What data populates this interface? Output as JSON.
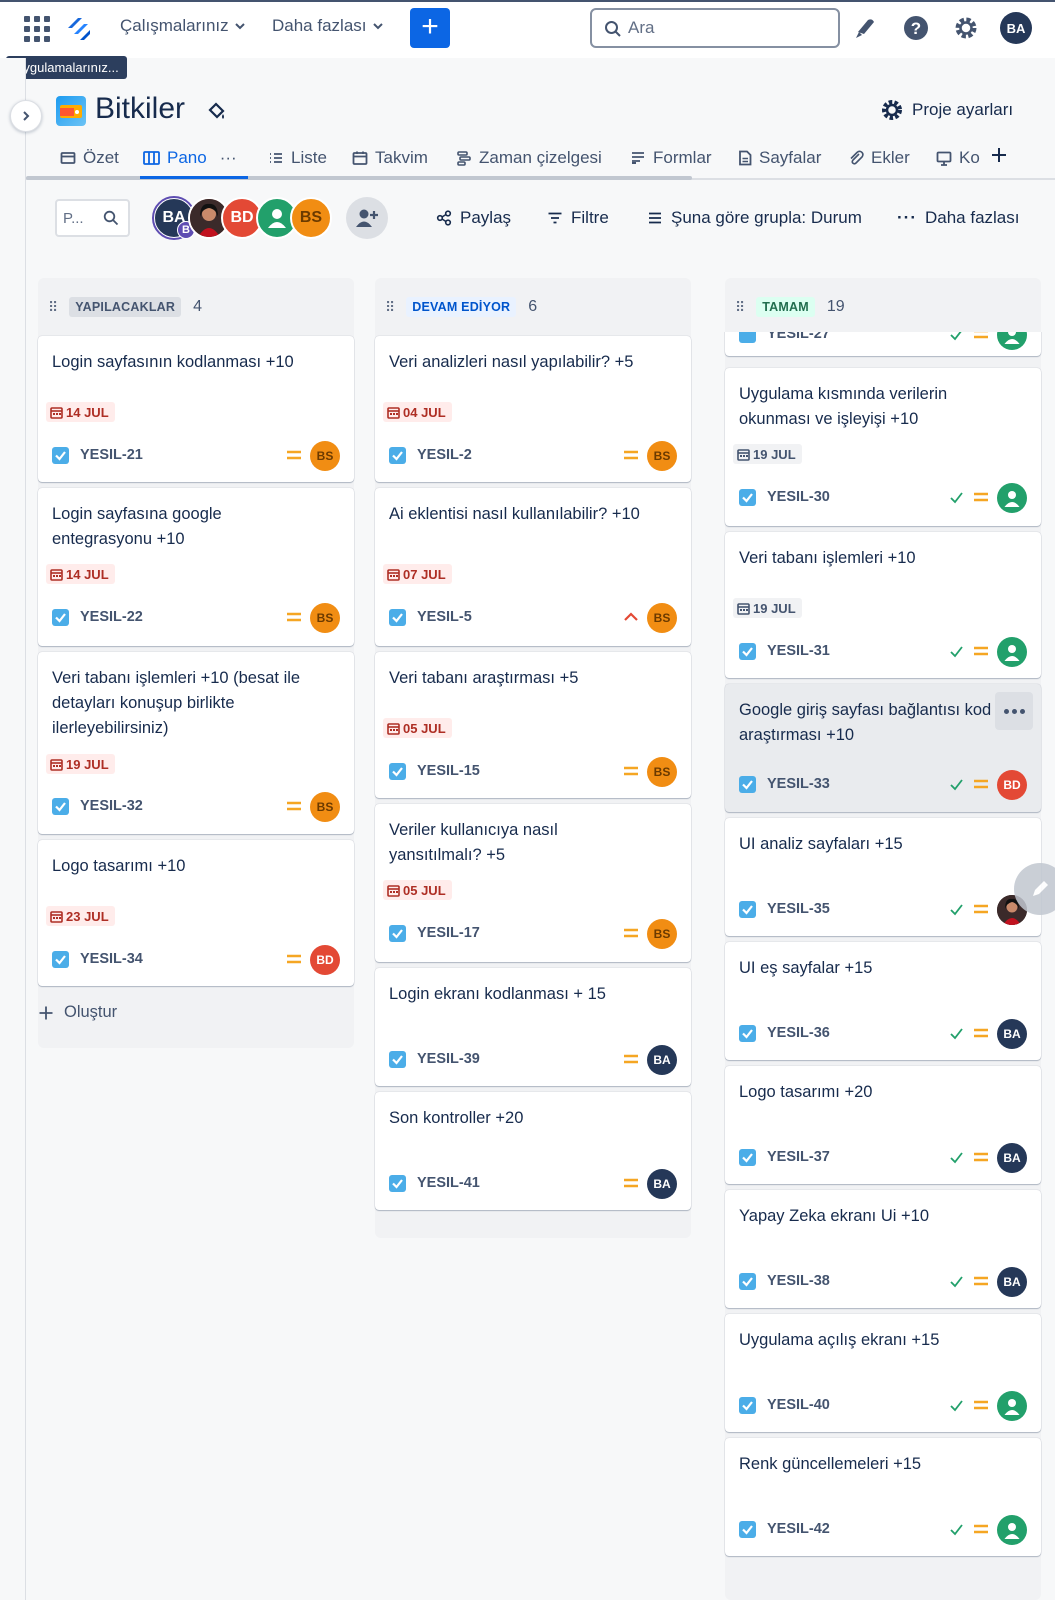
{
  "topnav": {
    "works_label": "Çalışmalarınız",
    "more_label": "Daha fazlası",
    "create_label": "+",
    "search_placeholder": "Ara",
    "user_initials": "BA",
    "apps_tooltip": "Uygulamalarınız..."
  },
  "project": {
    "name": "Bitkiler",
    "settings_label": "Proje ayarları"
  },
  "tabs": [
    {
      "label": "Özet"
    },
    {
      "label": "Pano",
      "more": "···"
    },
    {
      "label": "Liste"
    },
    {
      "label": "Takvim"
    },
    {
      "label": "Zaman çizelgesi"
    },
    {
      "label": "Formlar"
    },
    {
      "label": "Sayfalar"
    },
    {
      "label": "Ekler"
    },
    {
      "label": "Ko"
    }
  ],
  "toolbar": {
    "search_placeholder": "P...",
    "avatars": [
      {
        "initials": "BA",
        "badge": "B",
        "color": "#253858"
      },
      {
        "initials": "",
        "color": "#5e1f1f"
      },
      {
        "initials": "BD",
        "color": "#e34935"
      },
      {
        "initials": "",
        "color": "#22a06b"
      },
      {
        "initials": "BS",
        "color": "#f18d13"
      }
    ],
    "share_label": "Paylaş",
    "filter_label": "Filtre",
    "group_label": "Şuna göre grupla: Durum",
    "more_label": "Daha fazlası"
  },
  "columns": [
    {
      "name": "YAPILACAKLAR",
      "count": "4",
      "lozenge_bg": "#dcdfe4",
      "lozenge_fg": "#44546f",
      "create_label": "Oluştur",
      "cards": [
        {
          "title": "Login sayfasının kodlanması +10",
          "due": "14 JUL",
          "key": "YESIL-21",
          "assignee": "BS"
        },
        {
          "title": "Login sayfasına google entegrasyonu +10",
          "due": "14 JUL",
          "key": "YESIL-22",
          "assignee": "BS"
        },
        {
          "title": "Veri tabanı işlemleri +10 (besat ile detayları konuşup birlikte ilerleyebilirsiniz)",
          "due": "19 JUL",
          "key": "YESIL-32",
          "assignee": "BS"
        },
        {
          "title": "Logo tasarımı +10",
          "due": "23 JUL",
          "key": "YESIL-34",
          "assignee": "BD"
        }
      ]
    },
    {
      "name": "DEVAM EDİYOR",
      "count": "6",
      "lozenge_bg": "#e9f2ff",
      "lozenge_fg": "#0055cc",
      "cards": [
        {
          "title": "Veri analizleri nasıl yapılabilir? +5",
          "due": "04 JUL",
          "key": "YESIL-2",
          "assignee": "BS",
          "priority": "medium"
        },
        {
          "title": "Ai eklentisi nasıl kullanılabilir? +10",
          "due": "07 JUL",
          "key": "YESIL-5",
          "assignee": "BS",
          "priority": "high"
        },
        {
          "title": "Veri tabanı araştırması +5",
          "due": "05 JUL",
          "key": "YESIL-15",
          "assignee": "BS",
          "priority": "medium"
        },
        {
          "title": "Veriler kullanıcıya nasıl yansıtılmalı? +5",
          "due": "05 JUL",
          "key": "YESIL-17",
          "assignee": "BS",
          "priority": "medium"
        },
        {
          "title": "Login ekranı kodlanması + 15",
          "key": "YESIL-39",
          "assignee": "BA",
          "priority": "medium"
        },
        {
          "title": "Son kontroller +20",
          "key": "YESIL-41",
          "assignee": "BA",
          "priority": "medium"
        }
      ]
    },
    {
      "name": "TAMAM",
      "count": "19",
      "lozenge_bg": "#dcfff1",
      "lozenge_fg": "#216e4e",
      "partial_key": "YESIL-27",
      "cards": [
        {
          "title": "Uygulama kısmında verilerin okunması ve işleyişi +10",
          "due": "19 JUL",
          "key": "YESIL-30",
          "assignee": "user-green"
        },
        {
          "title": "Veri tabanı işlemleri +10",
          "due": "19 JUL",
          "key": "YESIL-31",
          "assignee": "user-green"
        },
        {
          "title": "Google giriş sayfası bağlantısı kod araştırması +10",
          "key": "YESIL-33",
          "assignee": "BD"
        },
        {
          "title": "UI analiz sayfaları +15",
          "key": "YESIL-35",
          "assignee": "photo"
        },
        {
          "title": "UI eş sayfalar +15",
          "key": "YESIL-36",
          "assignee": "BA"
        },
        {
          "title": "Logo tasarımı +20",
          "key": "YESIL-37",
          "assignee": "BA"
        },
        {
          "title": "Yapay Zeka ekranı Ui +10",
          "key": "YESIL-38",
          "assignee": "BA"
        },
        {
          "title": "Uygulama açılış ekranı +15",
          "key": "YESIL-40",
          "assignee": "user-green"
        },
        {
          "title": "Renk güncellemeleri +15",
          "key": "YESIL-42",
          "assignee": "user-green"
        }
      ]
    }
  ],
  "colors": {
    "accent": "#0c66e4",
    "bs": "#f18d13",
    "bd": "#e34935",
    "ba": "#253858",
    "green_user": "#22a06b",
    "priority_medium": "#f5a623",
    "priority_high": "#e34935",
    "done_check": "#22a06b"
  }
}
